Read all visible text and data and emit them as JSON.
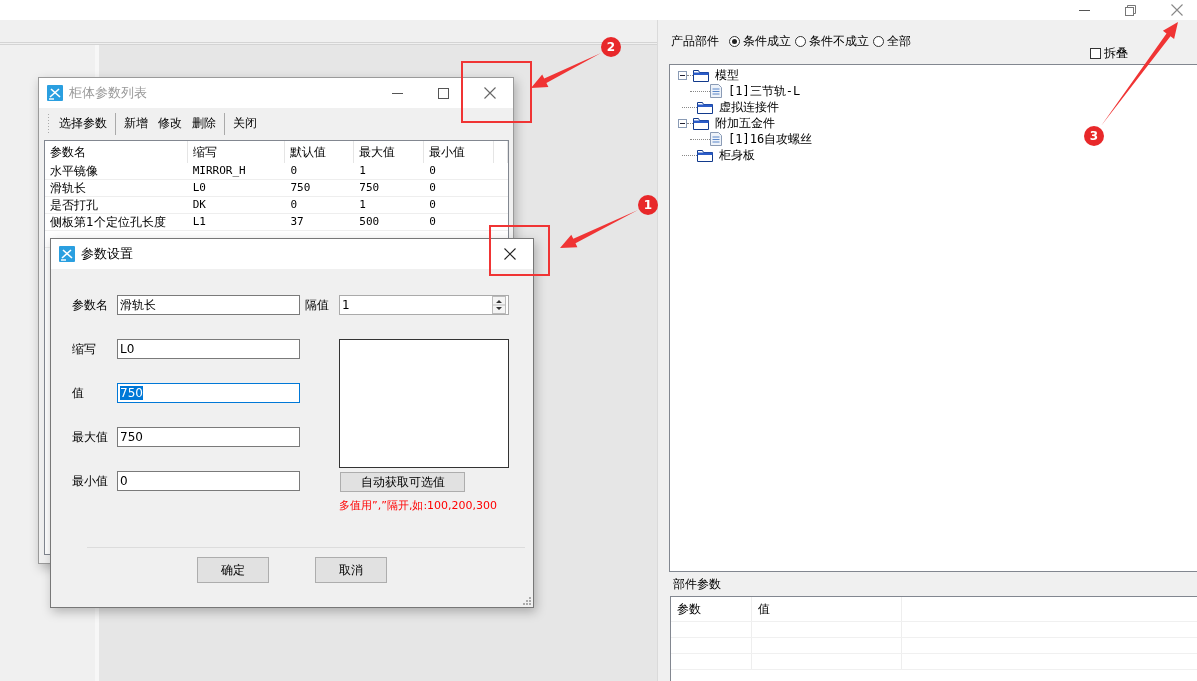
{
  "list_window": {
    "title": "柜体参数列表",
    "toolbar": [
      [
        "选择参数"
      ],
      [
        "新增",
        "修改",
        "删除"
      ],
      [
        "关闭"
      ]
    ],
    "table": {
      "columns": [
        "参数名",
        "缩写",
        "默认值",
        "最大值",
        "最小值"
      ],
      "rows": [
        [
          "水平镜像",
          "MIRROR_H",
          "0",
          "1",
          "0"
        ],
        [
          "滑轨长",
          "L0",
          "750",
          "750",
          "0"
        ],
        [
          "是否打孔",
          "DK",
          "0",
          "1",
          "0"
        ],
        [
          "侧板第1个定位孔长度",
          "L1",
          "37",
          "500",
          "0"
        ]
      ]
    }
  },
  "dialog": {
    "title": "参数设置",
    "name_field": {
      "label": "参数名",
      "value": "滑轨长"
    },
    "interval_field": {
      "label": "隔值",
      "value": "1"
    },
    "fields": [
      {
        "label": "缩写",
        "value": "L0",
        "focused": false
      },
      {
        "label": "值",
        "value": "750",
        "focused": true
      },
      {
        "label": "最大值",
        "value": "750",
        "focused": false
      },
      {
        "label": "最小值",
        "value": "0",
        "focused": false
      }
    ],
    "auto_button": "自动获取可选值",
    "hint": "多值用”,”隔开,如:100,200,300",
    "buttons": [
      "确定",
      "取消"
    ]
  },
  "product_panel": {
    "label": "产品部件",
    "filters": [
      {
        "label": "条件成立",
        "selected": true
      },
      {
        "label": "条件不成立",
        "selected": false
      },
      {
        "label": "全部",
        "selected": false
      }
    ],
    "collapse": {
      "label": "拆叠",
      "checked": false
    },
    "tree": [
      {
        "label": "模型",
        "kind": "folder",
        "expanded": true,
        "children": [
          {
            "label": "[1]三节轨-L",
            "kind": "file"
          }
        ]
      },
      {
        "label": "虚拟连接件",
        "kind": "folder",
        "expanded": false
      },
      {
        "label": "附加五金件",
        "kind": "folder",
        "expanded": true,
        "children": [
          {
            "label": "[1]16自攻螺丝",
            "kind": "file"
          }
        ]
      },
      {
        "label": "柜身板",
        "kind": "folder",
        "expanded": false
      }
    ]
  },
  "params_panel": {
    "label": "部件参数",
    "columns": [
      "参数",
      "值"
    ]
  },
  "annotations": [
    {
      "number": "1"
    },
    {
      "number": "2"
    },
    {
      "number": "3"
    }
  ]
}
